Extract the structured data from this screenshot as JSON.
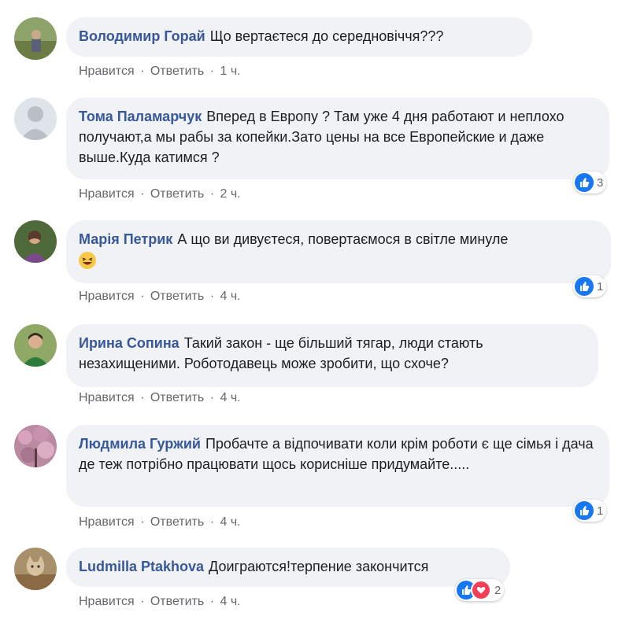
{
  "actions": {
    "like": "Нравится",
    "reply": "Ответить",
    "separator": "·"
  },
  "comments": [
    {
      "author": "Володимир Горай",
      "text": "Що вертаєтеся до середновіччя???",
      "time": "1 ч.",
      "avatar": "avatar-photo",
      "reaction_count": ""
    },
    {
      "author": "Тома Паламарчук",
      "text": "Вперед в Европу ? Там уже 4 дня работают и неплохо получают,а мы рабы за копейки.Зато цены на все Европейские и даже выше.Куда катимся ?",
      "time": "2 ч.",
      "avatar": "default-avatar",
      "reaction_count": "3"
    },
    {
      "author": "Марія Петрик",
      "text": "А що ви дивуєтеся, повертаємося в світле минуле",
      "time": "4 ч.",
      "avatar": "avatar-photo",
      "reaction_count": "1"
    },
    {
      "author": "Ирина Сопина",
      "text": "Такий закон - ще більший тягар, люди стають незахищеними. Роботодавець може зробити, що схоче?",
      "time": "4 ч.",
      "avatar": "avatar-photo",
      "reaction_count": ""
    },
    {
      "author": "Людмила Гуржий",
      "text": "Пробачте а відпочивати коли крім роботи є ще сімья і дача де теж потрібно працювати щось корисніше придумайте.....",
      "time": "4 ч.",
      "avatar": "avatar-photo",
      "reaction_count": "1"
    },
    {
      "author": "Ludmilla Ptakhova",
      "text": "Доиграются!терпение закончится",
      "time": "4 ч.",
      "avatar": "avatar-photo",
      "reaction_count": "2"
    }
  ],
  "colors": {
    "author": "#385898",
    "bubble": "#f0f2f5",
    "meta": "#65676b",
    "like": "#1877f2",
    "love": "#f33e58"
  }
}
